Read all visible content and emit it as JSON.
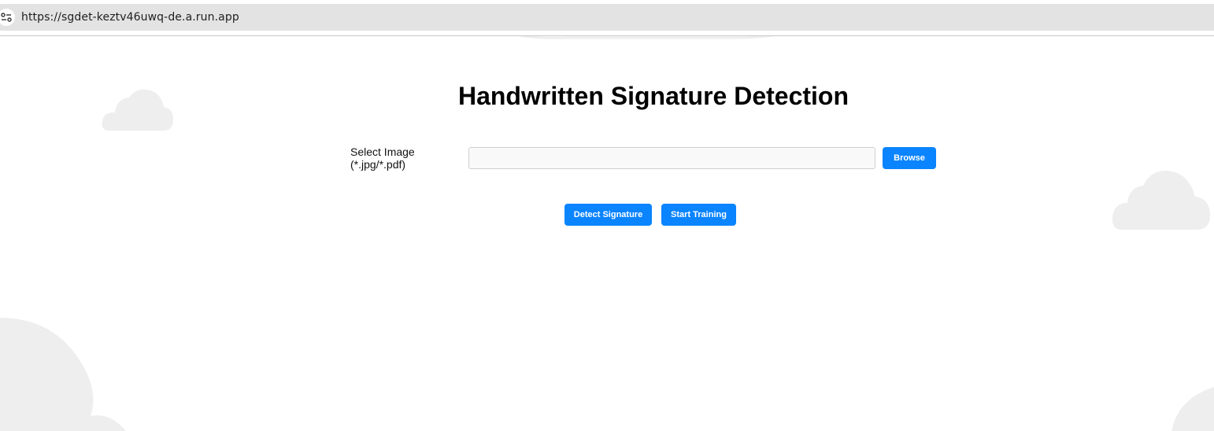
{
  "browser": {
    "url": "https://sgdet-keztv46uwq-de.a.run.app",
    "site_info_icon": "tune-icon"
  },
  "page": {
    "title": "Handwritten Signature Detection",
    "file_label": "Select Image (*.jpg/*.pdf)",
    "file_input_value": "",
    "browse_label": "Browse",
    "detect_label": "Detect Signature",
    "train_label": "Start Training"
  },
  "colors": {
    "accent": "#0a84ff",
    "cloud": "#eeeeee",
    "urlbar": "#e3e3e3"
  }
}
